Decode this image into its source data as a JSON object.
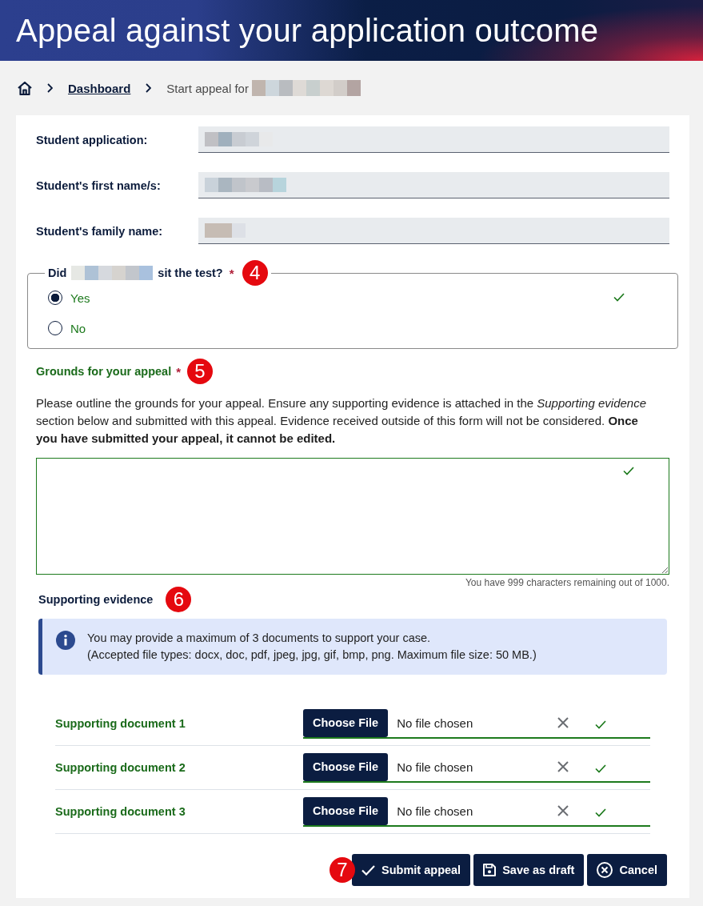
{
  "header": {
    "title": "Appeal against your application outcome"
  },
  "breadcrumb": [
    {
      "kind": "home"
    },
    {
      "kind": "link",
      "label": "Dashboard"
    },
    {
      "kind": "current",
      "label": "Start appeal for",
      "redacted": true
    }
  ],
  "fields": [
    {
      "label": "Student application:",
      "redacted": true
    },
    {
      "label": "Student's first name/s:",
      "redacted": true
    },
    {
      "label": "Student's family name:",
      "redacted": true
    }
  ],
  "question": {
    "text_before": "Did",
    "redacted": true,
    "text_after": "sit the test?",
    "required_mark": "*",
    "callout": "4",
    "valid": true,
    "options": [
      {
        "label": "Yes",
        "selected": true
      },
      {
        "label": "No",
        "selected": false
      }
    ]
  },
  "grounds": {
    "label": "Grounds for your appeal",
    "required_mark": "*",
    "callout": "5",
    "instructions": "Please outline the grounds for your appeal. Ensure any supporting evidence is attached in the *Supporting evidence* section below and submitted with this appeal. Evidence received outside of this form will not be considered. **Once you have submitted your appeal, it cannot be edited.**",
    "valid": true,
    "counter": "You have 999 characters remaining out of 1000."
  },
  "evidence": {
    "title": "Supporting evidence",
    "callout": "6",
    "info": [
      "You may provide a maximum of 3 documents to support your case.",
      "(Accepted file types: docx, doc, pdf, jpeg, jpg, gif, bmp, png. Maximum file size: 50 MB.)"
    ],
    "documents": [
      {
        "label": "Supporting document 1",
        "button": "Choose File",
        "status": "No file chosen",
        "valid": true
      },
      {
        "label": "Supporting document 2",
        "button": "Choose File",
        "status": "No file chosen",
        "valid": true
      },
      {
        "label": "Supporting document 3",
        "button": "Choose File",
        "status": "No file chosen",
        "valid": true
      }
    ]
  },
  "actions": {
    "callout": "7",
    "buttons": [
      {
        "kind": "submit",
        "label": "Submit appeal"
      },
      {
        "kind": "draft",
        "label": "Save as draft"
      },
      {
        "kind": "cancel",
        "label": "Cancel"
      }
    ]
  }
}
